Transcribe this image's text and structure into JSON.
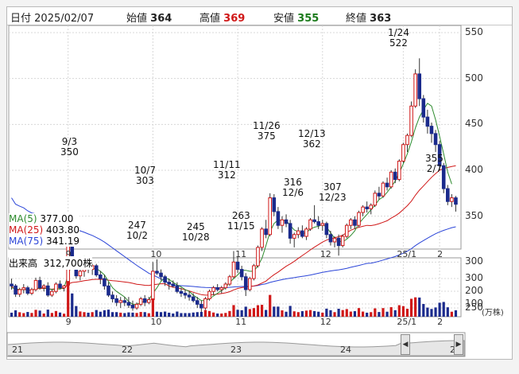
{
  "header": {
    "date_label": "日付",
    "date": "2025/02/07",
    "open_label": "始値",
    "open": "364",
    "high_label": "高値",
    "high": "369",
    "low_label": "安値",
    "low": "355",
    "close_label": "終値",
    "close": "363"
  },
  "colors": {
    "up": "#d01818",
    "down": "#1a2a8c",
    "ma5": "#2e8b2e",
    "ma25": "#d01818",
    "ma75": "#2b45d8",
    "high_text": "#d01818",
    "low_text": "#1a7a1a"
  },
  "legend": [
    {
      "label": "MA(5)",
      "value": "377.00",
      "color": "#2e8b2e"
    },
    {
      "label": "MA(25)",
      "value": "403.80",
      "color": "#d01818"
    },
    {
      "label": "MA(75)",
      "value": "341.19",
      "color": "#2b45d8"
    }
  ],
  "price_axis": {
    "ticks": [
      "550",
      "500",
      "450",
      "400",
      "350",
      "300",
      "250"
    ]
  },
  "month_labels": [
    "9",
    "10",
    "11",
    "12",
    "25/1",
    "2"
  ],
  "annotations": [
    {
      "date": "9/3",
      "value": "350"
    },
    {
      "date": "10/7",
      "value": "303"
    },
    {
      "value": "247",
      "date": "10/2"
    },
    {
      "date": "11/11",
      "value": "312"
    },
    {
      "value": "245",
      "date": "10/28"
    },
    {
      "value": "263",
      "date": "11/15"
    },
    {
      "date": "11/26",
      "value": "375"
    },
    {
      "date": "12/13",
      "value": "362"
    },
    {
      "value": "316",
      "date": "12/6"
    },
    {
      "value": "307",
      "date": "12/23"
    },
    {
      "date": "1/24",
      "value": "522"
    },
    {
      "value": "355",
      "date": "2/7"
    }
  ],
  "volume": {
    "label": "出来高",
    "value": "312,700株",
    "ticks": [
      "300",
      "200",
      "100"
    ],
    "unit": "(万株)"
  },
  "scrollbar": {
    "labels": [
      "21",
      "22",
      "23",
      "24",
      "2"
    ],
    "left_arrow": "◀",
    "right_arrow": "▶"
  },
  "chart_data": {
    "type": "candlestick",
    "ylim": [
      200,
      560
    ],
    "candles": [
      [
        276,
        282,
        270,
        274
      ],
      [
        274,
        276,
        262,
        265
      ],
      [
        265,
        272,
        262,
        270
      ],
      [
        270,
        276,
        266,
        272
      ],
      [
        272,
        274,
        264,
        266
      ],
      [
        266,
        272,
        264,
        270
      ],
      [
        270,
        283,
        268,
        280
      ],
      [
        280,
        284,
        270,
        272
      ],
      [
        272,
        276,
        268,
        274
      ],
      [
        274,
        278,
        262,
        264
      ],
      [
        264,
        270,
        262,
        268
      ],
      [
        268,
        278,
        266,
        276
      ],
      [
        276,
        280,
        270,
        272
      ],
      [
        272,
        275,
        268,
        274
      ],
      [
        275,
        346,
        272,
        345
      ],
      [
        345,
        350,
        300,
        302
      ],
      [
        302,
        306,
        282,
        285
      ],
      [
        285,
        294,
        280,
        290
      ],
      [
        290,
        296,
        284,
        294
      ],
      [
        294,
        300,
        288,
        292
      ],
      [
        292,
        298,
        286,
        296
      ],
      [
        296,
        298,
        284,
        286
      ],
      [
        286,
        290,
        276,
        282
      ],
      [
        282,
        286,
        270,
        274
      ],
      [
        274,
        278,
        262,
        264
      ],
      [
        264,
        268,
        256,
        260
      ],
      [
        260,
        264,
        252,
        256
      ],
      [
        256,
        262,
        250,
        258
      ],
      [
        258,
        262,
        252,
        256
      ],
      [
        256,
        262,
        250,
        253
      ],
      [
        253,
        258,
        247,
        250
      ],
      [
        250,
        256,
        248,
        254
      ],
      [
        254,
        262,
        252,
        260
      ],
      [
        260,
        264,
        252,
        256
      ],
      [
        256,
        262,
        254,
        259
      ],
      [
        259,
        300,
        258,
        290
      ],
      [
        290,
        303,
        286,
        288
      ],
      [
        288,
        292,
        280,
        284
      ],
      [
        284,
        286,
        274,
        278
      ],
      [
        278,
        282,
        270,
        276
      ],
      [
        276,
        280,
        272,
        274
      ],
      [
        274,
        278,
        266,
        268
      ],
      [
        268,
        272,
        262,
        266
      ],
      [
        266,
        270,
        260,
        264
      ],
      [
        264,
        268,
        258,
        262
      ],
      [
        262,
        266,
        256,
        258
      ],
      [
        258,
        262,
        250,
        254
      ],
      [
        254,
        258,
        245,
        250
      ],
      [
        250,
        262,
        248,
        260
      ],
      [
        260,
        270,
        258,
        268
      ],
      [
        268,
        274,
        264,
        272
      ],
      [
        272,
        276,
        268,
        270
      ],
      [
        270,
        274,
        266,
        272
      ],
      [
        272,
        278,
        270,
        276
      ],
      [
        276,
        286,
        274,
        284
      ],
      [
        284,
        312,
        282,
        300
      ],
      [
        300,
        306,
        288,
        292
      ],
      [
        292,
        296,
        280,
        284
      ],
      [
        284,
        288,
        263,
        270
      ],
      [
        270,
        284,
        268,
        282
      ],
      [
        282,
        298,
        280,
        296
      ],
      [
        296,
        318,
        294,
        316
      ],
      [
        316,
        338,
        312,
        336
      ],
      [
        336,
        346,
        326,
        330
      ],
      [
        330,
        375,
        328,
        370
      ],
      [
        370,
        374,
        350,
        355
      ],
      [
        355,
        360,
        336,
        340
      ],
      [
        340,
        350,
        332,
        346
      ],
      [
        346,
        352,
        338,
        342
      ],
      [
        342,
        346,
        320,
        326
      ],
      [
        326,
        332,
        316,
        330
      ],
      [
        330,
        338,
        326,
        334
      ],
      [
        334,
        340,
        326,
        328
      ],
      [
        328,
        338,
        324,
        336
      ],
      [
        336,
        348,
        334,
        346
      ],
      [
        346,
        362,
        342,
        344
      ],
      [
        344,
        350,
        336,
        340
      ],
      [
        340,
        346,
        334,
        342
      ],
      [
        342,
        344,
        326,
        330
      ],
      [
        330,
        334,
        318,
        322
      ],
      [
        322,
        328,
        316,
        326
      ],
      [
        326,
        330,
        307,
        318
      ],
      [
        318,
        330,
        316,
        328
      ],
      [
        328,
        342,
        326,
        340
      ],
      [
        340,
        348,
        336,
        346
      ],
      [
        346,
        350,
        336,
        340
      ],
      [
        340,
        356,
        338,
        354
      ],
      [
        354,
        362,
        350,
        360
      ],
      [
        360,
        366,
        354,
        358
      ],
      [
        358,
        364,
        352,
        362
      ],
      [
        362,
        378,
        360,
        375
      ],
      [
        375,
        382,
        368,
        372
      ],
      [
        372,
        388,
        370,
        386
      ],
      [
        386,
        392,
        378,
        382
      ],
      [
        382,
        400,
        380,
        398
      ],
      [
        398,
        402,
        386,
        390
      ],
      [
        390,
        412,
        388,
        410
      ],
      [
        410,
        430,
        408,
        428
      ],
      [
        428,
        440,
        420,
        438
      ],
      [
        438,
        475,
        436,
        470
      ],
      [
        470,
        510,
        468,
        505
      ],
      [
        505,
        522,
        470,
        478
      ],
      [
        478,
        482,
        452,
        458
      ],
      [
        458,
        466,
        440,
        448
      ],
      [
        448,
        452,
        430,
        440
      ],
      [
        440,
        444,
        420,
        428
      ],
      [
        428,
        432,
        400,
        405
      ],
      [
        405,
        408,
        375,
        380
      ],
      [
        380,
        384,
        362,
        366
      ],
      [
        366,
        374,
        360,
        370
      ],
      [
        370,
        372,
        355,
        363
      ]
    ],
    "ma5": [
      272,
      271,
      270,
      270,
      270,
      269,
      271,
      272,
      272,
      271,
      270,
      270,
      271,
      272,
      286,
      299,
      301,
      302,
      306,
      300,
      293,
      293,
      290,
      286,
      279,
      272,
      268,
      265,
      262,
      257,
      254,
      254,
      256,
      257,
      259,
      266,
      272,
      279,
      283,
      281,
      278,
      275,
      273,
      270,
      268,
      264,
      261,
      258,
      258,
      260,
      263,
      266,
      269,
      272,
      278,
      282,
      286,
      291,
      291,
      290,
      290,
      296,
      304,
      318,
      333,
      342,
      346,
      345,
      345,
      340,
      335,
      333,
      331,
      332,
      336,
      338,
      339,
      341,
      338,
      332,
      326,
      323,
      322,
      325,
      329,
      334,
      342,
      347,
      352,
      357,
      362,
      368,
      371,
      376,
      382,
      388,
      397,
      407,
      418,
      431,
      446,
      458,
      466,
      473,
      470,
      455,
      437,
      418,
      398,
      385
    ]
  }
}
